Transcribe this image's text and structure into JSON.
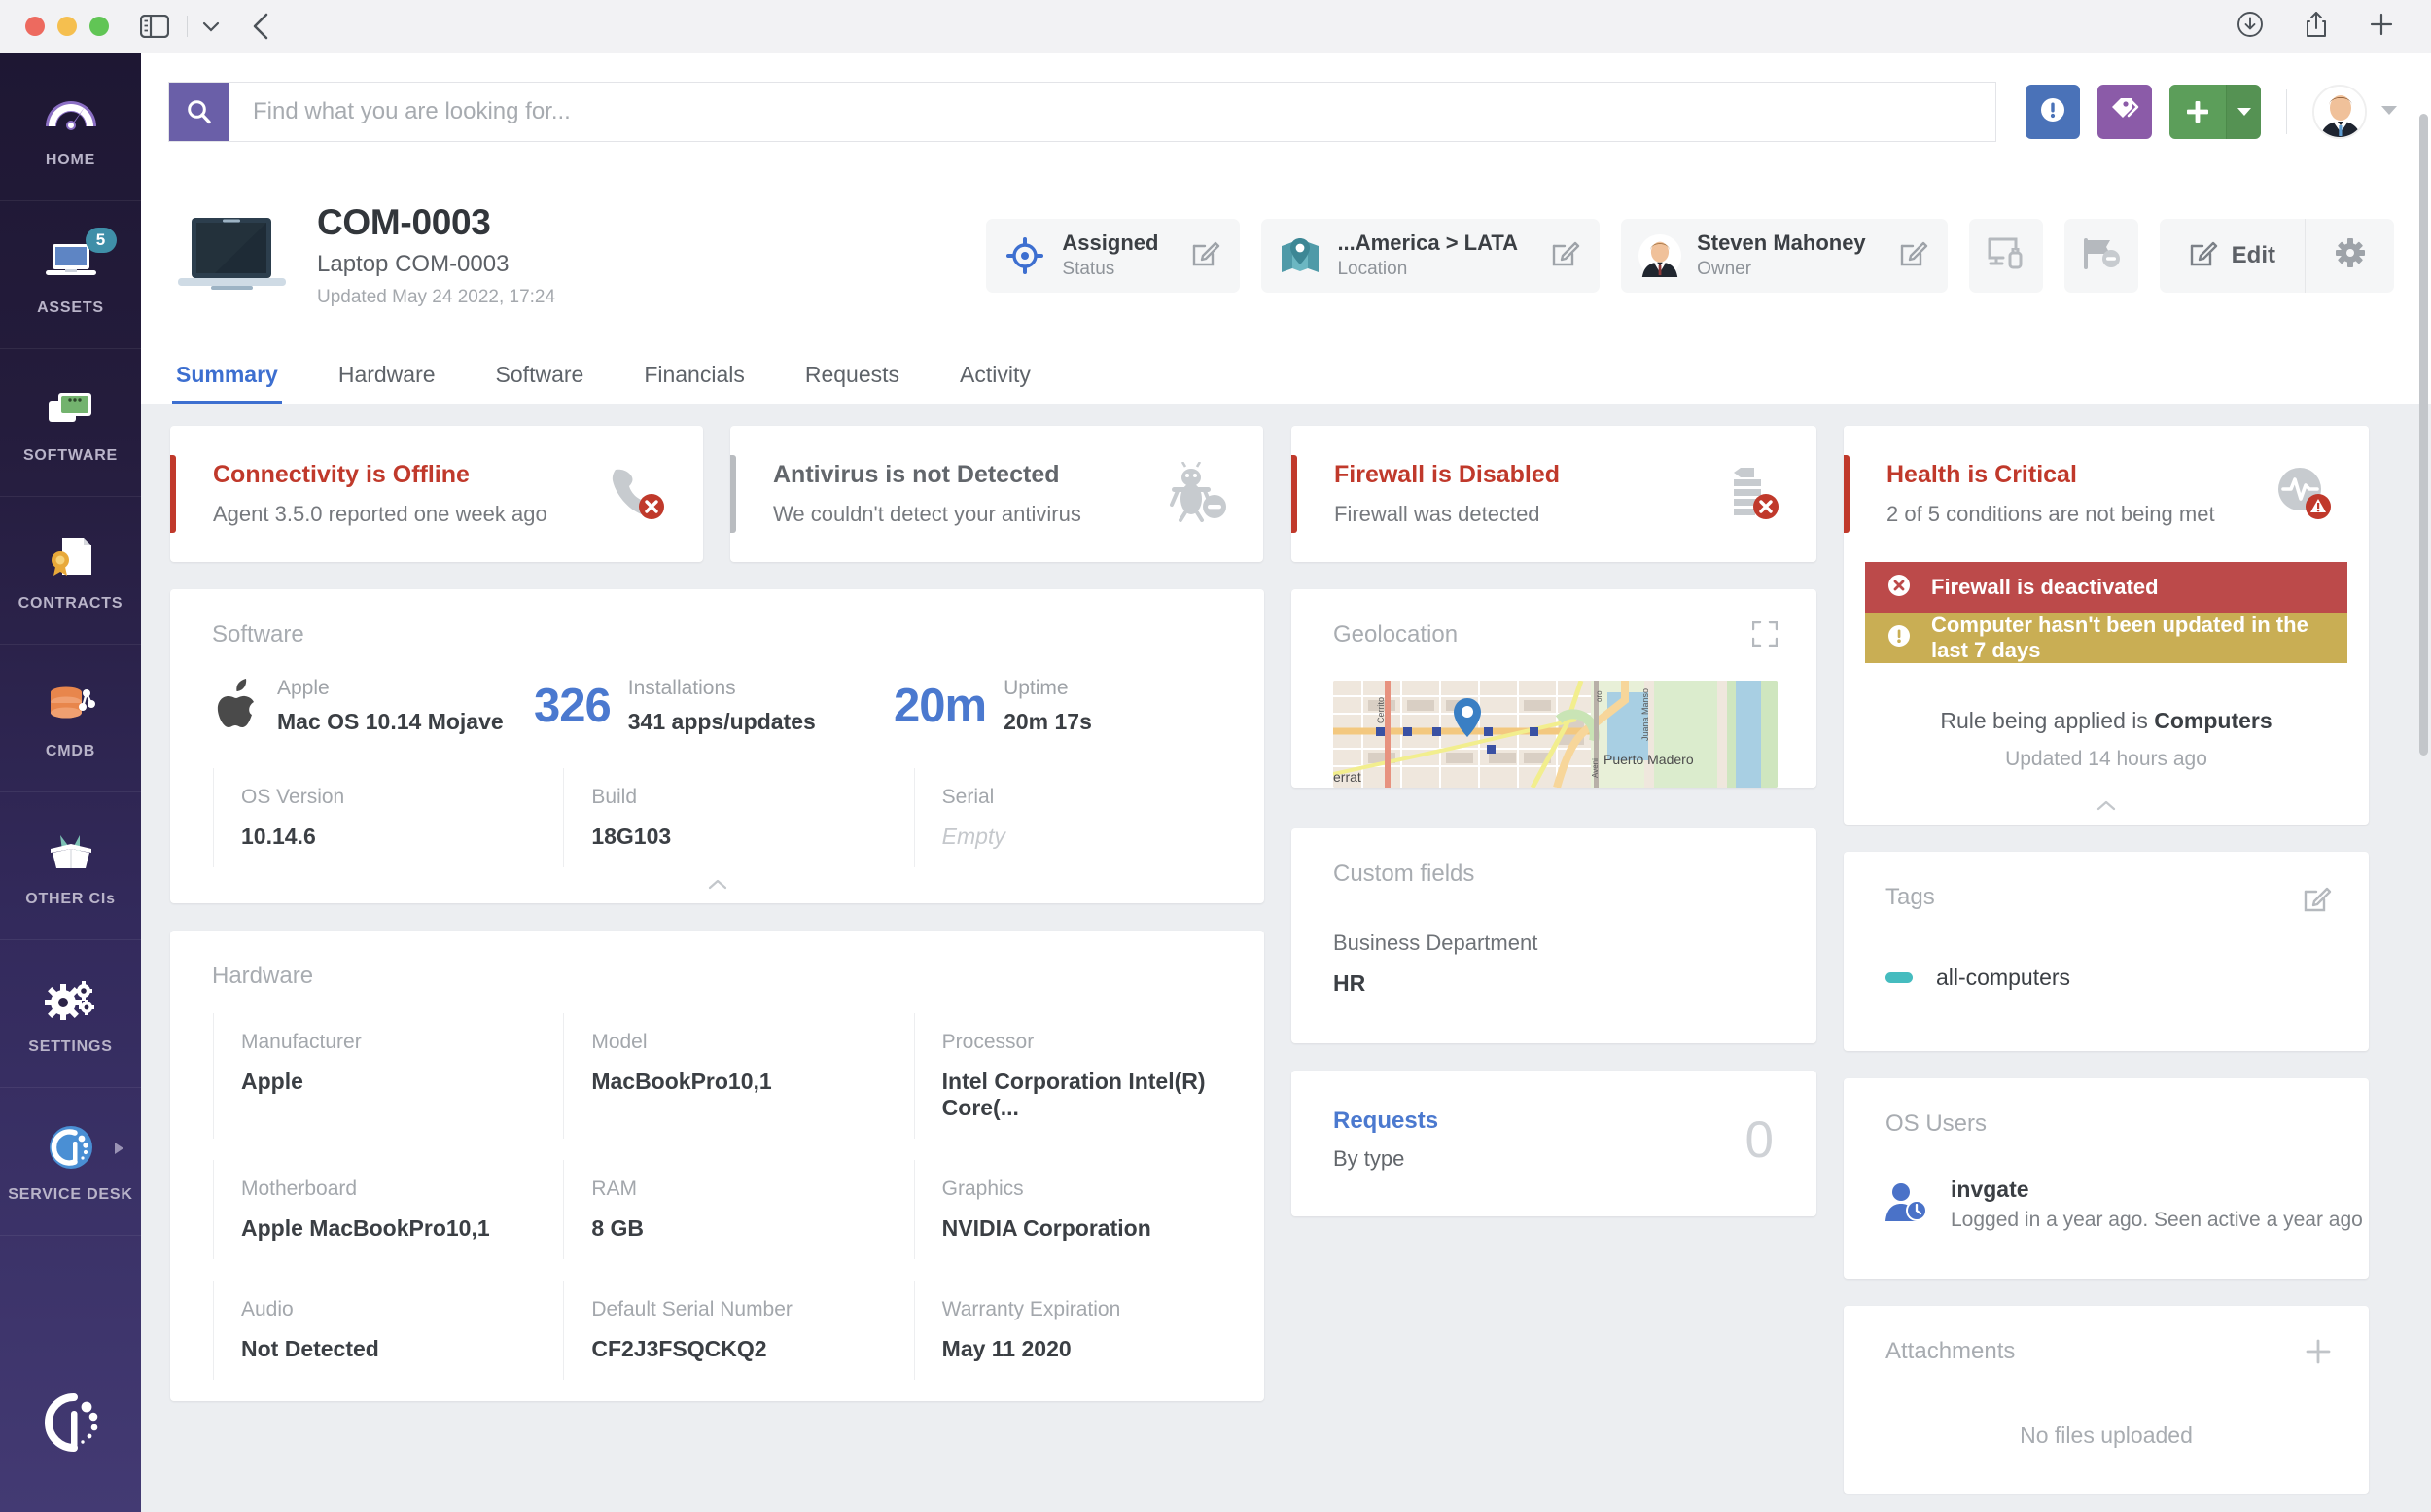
{
  "browser": {
    "sidebar_toggle_icon": "sidebar-toggle-icon",
    "chevron_icon": "chevron-down-icon",
    "back_icon": "back-arrow-icon",
    "download_icon": "download-icon",
    "share_icon": "share-icon",
    "newtab_icon": "plus-icon"
  },
  "sidebar": {
    "items": [
      {
        "label": "HOME",
        "icon": "speedometer-icon",
        "badge": null
      },
      {
        "label": "ASSETS",
        "icon": "laptop-icon",
        "badge": "5"
      },
      {
        "label": "SOFTWARE",
        "icon": "window-stack-icon",
        "badge": null
      },
      {
        "label": "CONTRACTS",
        "icon": "certificate-document-icon",
        "badge": null
      },
      {
        "label": "CMDB",
        "icon": "database-nodes-icon",
        "badge": null
      },
      {
        "label": "OTHER CIs",
        "icon": "open-box-icon",
        "badge": null
      },
      {
        "label": "SETTINGS",
        "icon": "gears-icon",
        "badge": null
      },
      {
        "label": "SERVICE DESK",
        "icon": "invgate-circle-icon",
        "badge": null
      }
    ],
    "logo": "invgate-logo"
  },
  "topbar": {
    "search_placeholder": "Find what you are looking for...",
    "search_value": "",
    "search_icon": "search-icon",
    "alert_icon": "exclamation-circle-icon",
    "tags_icon": "tags-icon",
    "add_icon": "plus-icon",
    "add_caret_icon": "caret-down-icon",
    "avatar": "user-avatar",
    "avatar_caret_icon": "caret-down-icon"
  },
  "asset": {
    "thumb_icon": "laptop-thumbnail-icon",
    "id": "COM-0003",
    "subtitle": "Laptop COM-0003",
    "updated": "Updated May 24 2022, 17:24",
    "chips": [
      {
        "icon": "target-status-icon",
        "main": "Assigned",
        "sub": "Status",
        "edit_icon": "edit-pencil-icon"
      },
      {
        "icon": "map-pin-icon",
        "main": "...America > LATA",
        "sub": "Location",
        "edit_icon": "edit-pencil-icon"
      },
      {
        "icon": "owner-avatar-icon",
        "main": "Steven Mahoney",
        "sub": "Owner",
        "edit_icon": "edit-pencil-icon"
      }
    ],
    "plain_buttons": [
      {
        "icon": "monitor-plug-icon"
      },
      {
        "icon": "flag-block-icon"
      }
    ],
    "edit_label": "Edit",
    "edit_icon": "edit-pencil-icon",
    "gear_icon": "gear-icon"
  },
  "tabs": [
    {
      "label": "Summary",
      "active": true
    },
    {
      "label": "Hardware",
      "active": false
    },
    {
      "label": "Software",
      "active": false
    },
    {
      "label": "Financials",
      "active": false
    },
    {
      "label": "Requests",
      "active": false
    },
    {
      "label": "Activity",
      "active": false
    }
  ],
  "alerts": [
    {
      "title": "Connectivity is Offline",
      "subtitle": "Agent 3.5.0 reported one week ago",
      "severity": "critical",
      "bar_color": "#c0392b",
      "icon": "connectivity-offline-icon"
    },
    {
      "title": "Antivirus is not Detected",
      "subtitle": "We couldn't detect your antivirus",
      "severity": "neutral",
      "bar_color": "#b9bcc0",
      "icon": "antivirus-not-detected-icon"
    },
    {
      "title": "Firewall is Disabled",
      "subtitle": "Firewall was detected",
      "severity": "critical",
      "bar_color": "#c0392b",
      "icon": "firewall-disabled-icon"
    },
    {
      "title": "Health is Critical",
      "subtitle": "2 of 5 conditions are not being met",
      "severity": "critical",
      "bar_color": "#c0392b",
      "icon": "health-critical-icon"
    }
  ],
  "software": {
    "card_title": "Software",
    "os_icon": "apple-logo-icon",
    "os_vendor": "Apple",
    "os_name": "Mac OS 10.14 Mojave",
    "installations_big": "326",
    "installations_label": "Installations",
    "installations_value": "341 apps/updates",
    "uptime_big": "20m",
    "uptime_label": "Uptime",
    "uptime_value": "20m 17s",
    "fields": [
      {
        "label": "OS Version",
        "value": "10.14.6",
        "empty": false
      },
      {
        "label": "Build",
        "value": "18G103",
        "empty": false
      },
      {
        "label": "Serial",
        "value": "Empty",
        "empty": true
      }
    ],
    "collapse_icon": "chevron-up-icon"
  },
  "hardware": {
    "card_title": "Hardware",
    "rows": [
      [
        {
          "label": "Manufacturer",
          "value": "Apple"
        },
        {
          "label": "Model",
          "value": "MacBookPro10,1"
        },
        {
          "label": "Processor",
          "value": "Intel Corporation Intel(R) Core(..."
        }
      ],
      [
        {
          "label": "Motherboard",
          "value": "Apple MacBookPro10,1"
        },
        {
          "label": "RAM",
          "value": "8 GB"
        },
        {
          "label": "Graphics",
          "value": "NVIDIA Corporation"
        }
      ],
      [
        {
          "label": "Audio",
          "value": "Not Detected"
        },
        {
          "label": "Default Serial Number",
          "value": "CF2J3FSQCKQ2"
        },
        {
          "label": "Warranty Expiration",
          "value": "May 11 2020"
        }
      ]
    ]
  },
  "geolocation": {
    "card_title": "Geolocation",
    "expand_icon": "expand-fullscreen-icon",
    "map_pin_icon": "map-marker-icon",
    "map_labels": [
      "Cerrito",
      "Puerto Madero",
      "Juana Manso",
      "errat",
      "Aveni"
    ]
  },
  "custom_fields": {
    "card_title": "Custom fields",
    "label": "Business Department",
    "value": "HR"
  },
  "requests": {
    "title": "Requests",
    "subtitle": "By type",
    "count": "0"
  },
  "health": {
    "conditions": [
      {
        "text": "Firewall is deactivated",
        "level": "critical",
        "icon": "x-circle-icon",
        "color": "#bc4a4a"
      },
      {
        "text": "Computer hasn't been updated in the last 7 days",
        "level": "warning",
        "icon": "exclamation-circle-icon",
        "color": "#c9ae54"
      }
    ],
    "rule_prefix": "Rule being applied is ",
    "rule_name": "Computers",
    "updated": "Updated 14 hours ago",
    "collapse_icon": "chevron-up-icon"
  },
  "tags": {
    "card_title": "Tags",
    "edit_icon": "edit-pencil-icon",
    "items": [
      {
        "name": "all-computers",
        "color": "#45bcbf"
      }
    ]
  },
  "os_users": {
    "card_title": "OS Users",
    "items": [
      {
        "icon": "user-clock-icon",
        "name": "invgate",
        "detail": "Logged in a year ago. Seen active a year ago"
      }
    ]
  },
  "attachments": {
    "card_title": "Attachments",
    "add_icon": "plus-icon",
    "empty_text": "No files uploaded"
  }
}
